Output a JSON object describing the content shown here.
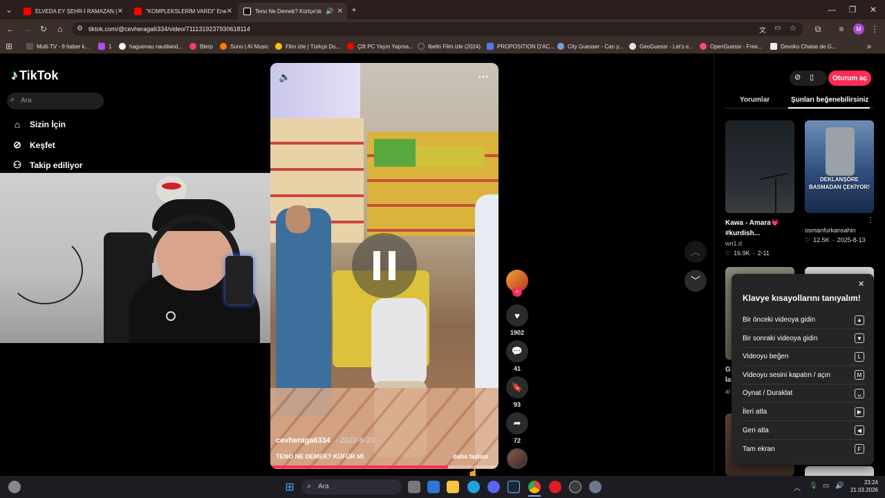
{
  "browser": {
    "tabs": [
      {
        "title": "ELVEDA EY ŞEHR-İ RAMAZAN |",
        "favicon": "youtube-icon",
        "color": "#ff0000"
      },
      {
        "title": "\"KOMPLEKSLERİM VARDI\" Ene",
        "favicon": "youtube-icon",
        "color": "#ff0000"
      },
      {
        "title": "Teno Ne Demek? Kürtçe'de",
        "favicon": "tiktok-icon",
        "color": "#000000"
      }
    ],
    "new_tab": "+",
    "url": "tiktok.com/@cevheraga6334/video/7111319237930618114",
    "bookmarks": [
      {
        "label": "Multi TV - 9 haber k...",
        "color": "#555"
      },
      {
        "label": "1",
        "color": "#b04cf0"
      },
      {
        "label": "haguenau nautiland...",
        "color": "#ffffff"
      },
      {
        "label": "Blerp",
        "color": "#ff3b6b"
      },
      {
        "label": "Suno | AI Music",
        "color": "#ff7a00"
      },
      {
        "label": "Film izle | Türkçe Du...",
        "color": "#f4c20d"
      },
      {
        "label": "Çift PC Yayın Yapma...",
        "color": "#ff0000"
      },
      {
        "label": "Ibelin Film izle (2024)",
        "color": "#333"
      },
      {
        "label": "PROPOSITION D'AC...",
        "color": "#4a7cf0"
      },
      {
        "label": "City Guesser - Can y...",
        "color": "#7aa0d0"
      },
      {
        "label": "GeoGuessr - Let's e...",
        "color": "#e8e2df"
      },
      {
        "label": "OpenGuessr - Free...",
        "color": "#ff4d6d"
      },
      {
        "label": "Devoko Chaise de G...",
        "color": "#eeeeee"
      }
    ],
    "profile_initial": "M"
  },
  "tiktok": {
    "logo": "TikTok",
    "search_placeholder": "Ara",
    "nav": [
      {
        "label": "Sizin İçin",
        "icon": "home-icon"
      },
      {
        "label": "Keşfet",
        "icon": "compass-icon"
      },
      {
        "label": "Takip ediliyor",
        "icon": "following-icon"
      }
    ],
    "login_button": "Oturum aç",
    "right_tabs": [
      "Yorumlar",
      "Şunları beğenebilirsiniz"
    ],
    "video": {
      "author": "cevheraga6334",
      "date": "· 2022-6-20",
      "caption": "TENO NE DEMEK? KÜFÜR Mİ",
      "more": "daha fazlası",
      "progress_fraction": 0.78
    },
    "actions": {
      "likes": "1902",
      "comments": "41",
      "saves": "93",
      "shares": "72"
    },
    "suggestions": [
      {
        "title": "Kawa - Amara💗 #kurdish...",
        "author": "wn1.d",
        "likes": "16.9K",
        "date": "2-11"
      },
      {
        "title": "DEKLANŞÖRE BASMADAN ÇEKİYOR!",
        "author": "osmanfurkansahin",
        "likes": "12.5K",
        "date": "2025-8-13"
      }
    ],
    "partial_card_text": [
      "G",
      "la",
      "al"
    ],
    "shortcuts": {
      "title": "Klavye kısayollarını tanıyalım!",
      "rows": [
        {
          "label": "Bir önceki videoya gidin",
          "key": "▲"
        },
        {
          "label": "Bir sonraki videoya gidin",
          "key": "▼"
        },
        {
          "label": "Videoyu beğen",
          "key": "L"
        },
        {
          "label": "Videoyu sesini kapatın / açın",
          "key": "M"
        },
        {
          "label": "Oynat / Duraklat",
          "key": "␣"
        },
        {
          "label": "İleri atla",
          "key": "▶"
        },
        {
          "label": "Geri atla",
          "key": "◀"
        },
        {
          "label": "Tam ekran",
          "key": "F"
        }
      ]
    }
  },
  "taskbar": {
    "search_placeholder": "Ara",
    "time": "23:24",
    "date": "21.03.2026"
  },
  "colors": {
    "tiktok_accent": "#fe2c55",
    "background": "#000000"
  }
}
